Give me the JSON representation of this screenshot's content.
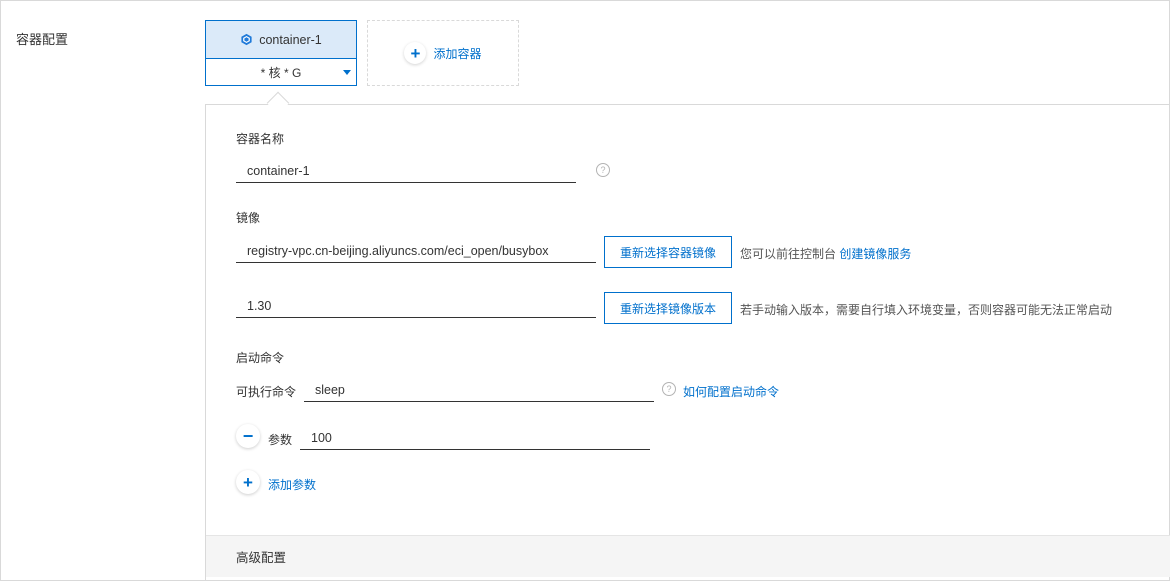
{
  "section_label": "容器配置",
  "container_tab": {
    "name": "container-1",
    "spec": "* 核 * G"
  },
  "add_container_label": "添加容器",
  "form": {
    "name_label": "容器名称",
    "name_value": "container-1",
    "image_label": "镜像",
    "image_value": "registry-vpc.cn-beijing.aliyuncs.com/eci_open/busybox",
    "reselect_image_button": "重新选择容器镜像",
    "image_hint_prefix": "您可以前往控制台",
    "image_hint_link": "创建镜像服务",
    "version_value": "1.30",
    "reselect_version_button": "重新选择镜像版本",
    "version_hint": "若手动输入版本，需要自行填入环境变量，否则容器可能无法正常启动",
    "startup_label": "启动命令",
    "exec_label": "可执行命令",
    "exec_value": "sleep",
    "exec_help_link": "如何配置启动命令",
    "param_label": "参数",
    "param_value": "100",
    "add_param_label": "添加参数"
  },
  "advanced_label": "高级配置",
  "icons": {
    "container": "cube-icon",
    "help": "question-circle-icon",
    "add": "plus-icon",
    "remove": "minus-icon",
    "dropdown": "caret-down-icon"
  },
  "colors": {
    "accent": "#0070cc",
    "tab_bg": "#dbeaf9",
    "footer_bg": "#f5f5f5"
  }
}
